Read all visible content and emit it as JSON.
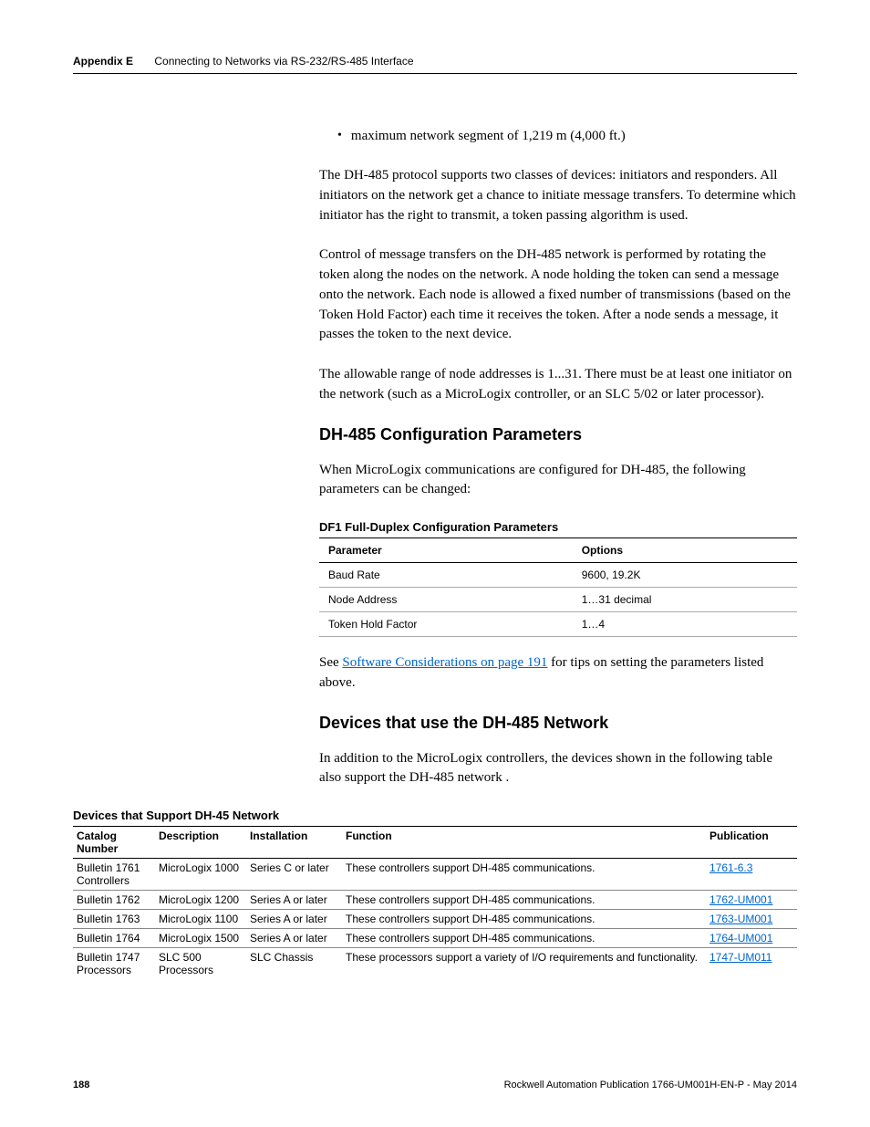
{
  "header": {
    "appendix": "Appendix E",
    "title": "Connecting to Networks via RS-232/RS-485 Interface"
  },
  "bullet": "maximum network segment of 1,219 m (4,000 ft.)",
  "para1": "The DH-485 protocol supports two classes of devices: initiators and responders. All initiators on the network get a chance to initiate message transfers. To determine which initiator has the right to transmit, a token passing algorithm is used.",
  "para2": "Control of message transfers on the DH-485 network is performed by rotating the token along the nodes on the network. A node holding the token can send a message onto the network. Each node is allowed a fixed number of transmissions (based on the Token Hold Factor) each time it receives the token. After a node sends a message, it passes the token to the next device.",
  "para3": "The allowable range of node addresses is 1...31. There must be at least one initiator on the network (such as a MicroLogix controller, or an SLC 5/02 or later processor).",
  "section1": "DH-485 Configuration Parameters",
  "para4": "When MicroLogix communications are configured for DH-485, the following parameters can be changed:",
  "param_table": {
    "title": "DF1 Full-Duplex Configuration Parameters",
    "headers": [
      "Parameter",
      "Options"
    ],
    "rows": [
      [
        "Baud Rate",
        "9600, 19.2K"
      ],
      [
        "Node Address",
        "1…31 decimal"
      ],
      [
        "Token Hold Factor",
        "1…4"
      ]
    ]
  },
  "see_prefix": "See ",
  "see_link": "Software Considerations on page 191",
  "see_suffix": " for tips on setting the parameters listed above.",
  "section2": "Devices that use the DH-485 Network",
  "para5": "In addition to the MicroLogix controllers, the devices shown in the following table also support the DH-485 network   .",
  "devices_table": {
    "title": "Devices that Support DH-45 Network",
    "headers": [
      "Catalog Number",
      "Description",
      "Installation",
      "Function",
      "Publication"
    ],
    "rows": [
      {
        "c1": "Bulletin 1761 Controllers",
        "c2": "MicroLogix 1000",
        "c3": "Series C or later",
        "c4": "These controllers support DH-485 communications.",
        "c5": "1761-6.3"
      },
      {
        "c1": "Bulletin 1762",
        "c2": "MicroLogix 1200",
        "c3": "Series A or later",
        "c4": "These controllers support DH-485 communications.",
        "c5": "1762-UM001"
      },
      {
        "c1": "Bulletin 1763",
        "c2": "MicroLogix 1100",
        "c3": "Series A or later",
        "c4": "These controllers support DH-485 communications.",
        "c5": "1763-UM001"
      },
      {
        "c1": "Bulletin 1764",
        "c2": "MicroLogix 1500",
        "c3": "Series A or later",
        "c4": "These controllers support DH-485 communications.",
        "c5": "1764-UM001"
      },
      {
        "c1": "Bulletin 1747 Processors",
        "c2": "SLC 500 Processors",
        "c3": "SLC Chassis",
        "c4": "These processors support a variety of I/O requirements and functionality.",
        "c5": "1747-UM011"
      }
    ]
  },
  "footer": {
    "page": "188",
    "pub": "Rockwell Automation Publication 1766-UM001H-EN-P - May 2014"
  }
}
